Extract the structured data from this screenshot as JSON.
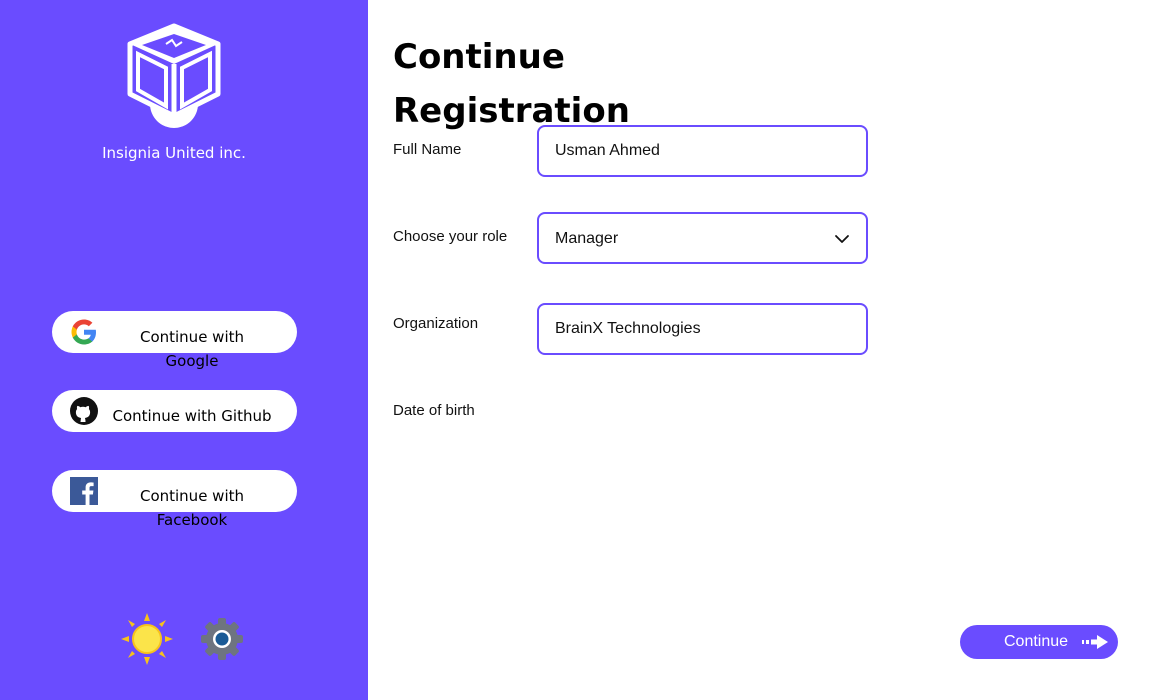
{
  "sidebar": {
    "company_name": "Insignia United inc.",
    "background_color": "#6a4cff",
    "social_buttons": [
      {
        "label": "Continue with Google",
        "icon": "google-icon"
      },
      {
        "label": "Continue with Github",
        "icon": "github-icon"
      },
      {
        "label": "Continue with Facebook",
        "icon": "facebook-icon"
      }
    ],
    "footer_icons": [
      "sun-icon",
      "gear-icon"
    ]
  },
  "main": {
    "title": "Continue Registration",
    "fields": {
      "full_name": {
        "label": "Full Name",
        "value": "Usman Ahmed"
      },
      "role": {
        "label": "Choose your role",
        "value": "Manager"
      },
      "organization": {
        "label": "Organization",
        "value": "BrainX Technologies"
      },
      "date_of_birth": {
        "label": "Date of birth"
      }
    },
    "continue_label": "Continue"
  },
  "colors": {
    "accent": "#6a4cff",
    "background": "#ffffff"
  }
}
